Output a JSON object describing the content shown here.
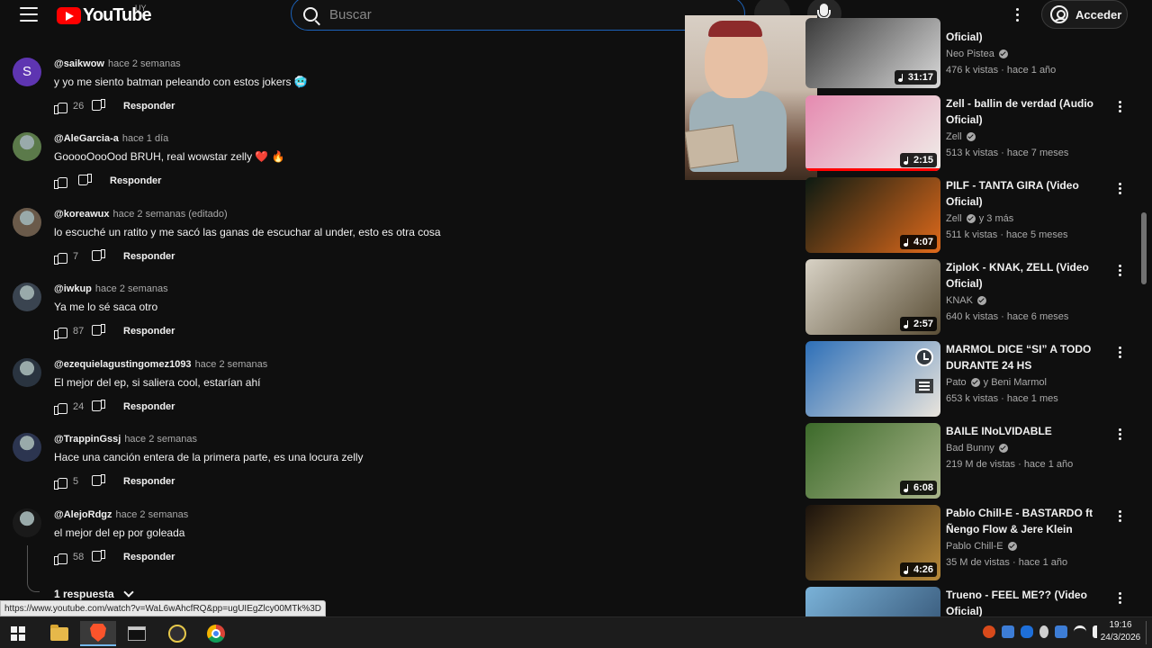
{
  "header": {
    "logo_text": "YouTube",
    "country": "UY",
    "search_placeholder": "Buscar",
    "signin_label": "Acceder"
  },
  "comments": [
    {
      "author": "@saikwow",
      "time": "hace 2 semanas",
      "text": "y yo me siento batman peleando con estos jokers 🥶",
      "likes": "26",
      "reply": "Responder",
      "avatar": "S"
    },
    {
      "author": "@AleGarcia-a",
      "time": "hace 1 día",
      "text": "GooooOooOod BRUH, real wowstar zelly ❤️ 🔥",
      "likes": "",
      "reply": "Responder",
      "avatar": ""
    },
    {
      "author": "@koreawux",
      "time": "hace 2 semanas (editado)",
      "text": "lo escuché un ratito y me sacó las ganas de escuchar al under, esto es otra cosa",
      "likes": "7",
      "reply": "Responder",
      "avatar": ""
    },
    {
      "author": "@iwkup",
      "time": "hace 2 semanas",
      "text": "Ya me lo sé saca otro",
      "likes": "87",
      "reply": "Responder",
      "avatar": ""
    },
    {
      "author": "@ezequielagustingomez1093",
      "time": "hace 2 semanas",
      "text": "El mejor del ep, si saliera cool, estarían ahí",
      "likes": "24",
      "reply": "Responder",
      "avatar": ""
    },
    {
      "author": "@TrappinGssj",
      "time": "hace 2 semanas",
      "text": "Hace una canción entera de la primera parte, es una locura zelly",
      "likes": "5",
      "reply": "Responder",
      "avatar": ""
    },
    {
      "author": "@AlejoRdgz",
      "time": "hace 2 semanas",
      "text": "el mejor del ep por goleada",
      "likes": "58",
      "reply": "Responder",
      "avatar": ""
    }
  ],
  "replies_label": "1 respuesta",
  "sidebar": [
    {
      "title": "Oficial)",
      "channel": "Neo Pistea",
      "verified": true,
      "meta": "476 k vistas · hace 1 año",
      "duration": "31:17",
      "music": true,
      "colors": [
        "#3a3a3a",
        "#d9d9d9"
      ]
    },
    {
      "title": "Zell - ballin de verdad (Audio Oficial)",
      "channel": "Zell",
      "verified": true,
      "meta": "513 k vistas · hace 7 meses",
      "duration": "2:15",
      "music": true,
      "watched": true,
      "colors": [
        "#e58ab0",
        "#f0eee9"
      ]
    },
    {
      "title": "PILF - TANTA GIRA (Video Oficial)",
      "channel": "Zell",
      "channel_extra": "y 3 más",
      "verified": true,
      "meta": "511 k vistas · hace 5 meses",
      "duration": "4:07",
      "music": true,
      "colors": [
        "#0c1a12",
        "#e06a1b"
      ]
    },
    {
      "title": "ZiploK - KNAK, ZELL (Video Oficial)",
      "channel": "KNAK",
      "verified": true,
      "meta": "640 k vistas · hace 6 meses",
      "duration": "2:57",
      "music": true,
      "colors": [
        "#d8d2c5",
        "#5a4e36"
      ]
    },
    {
      "title": "MARMOL DICE “SI” A TODO DURANTE 24 HS",
      "channel": "Pato",
      "channel_extra": "y Beni Marmol",
      "verified": true,
      "meta": "653 k vistas · hace 1 mes",
      "duration": "",
      "music": false,
      "colors": [
        "#2d6fb8",
        "#e9e4dc"
      ]
    },
    {
      "title": "BAILE INoLVIDABLE",
      "channel": "Bad Bunny",
      "verified": true,
      "meta": "219 M de vistas · hace 1 año",
      "duration": "6:08",
      "music": true,
      "colors": [
        "#3c6a2a",
        "#a9b58a"
      ]
    },
    {
      "title": "Pablo Chill-E - BASTARDO ft Ñengo Flow & Jere Klein",
      "channel": "Pablo Chill-E",
      "verified": true,
      "meta": "35 M de vistas · hace 1 año",
      "duration": "4:26",
      "music": true,
      "colors": [
        "#1a120c",
        "#b88a3a"
      ]
    },
    {
      "title": "Trueno - FEEL ME?? (Video Oficial)",
      "channel": "",
      "verified": false,
      "meta": "",
      "duration": "",
      "music": false,
      "colors": [
        "#7ab2d8",
        "#2d4a6a"
      ]
    }
  ],
  "status_url": "https://www.youtube.com/watch?v=WaL6wAhcfRQ&pp=ugUIEgZlcy00MTk%3D",
  "taskbar": {
    "time": "19:16",
    "date": "24/3/2026"
  }
}
